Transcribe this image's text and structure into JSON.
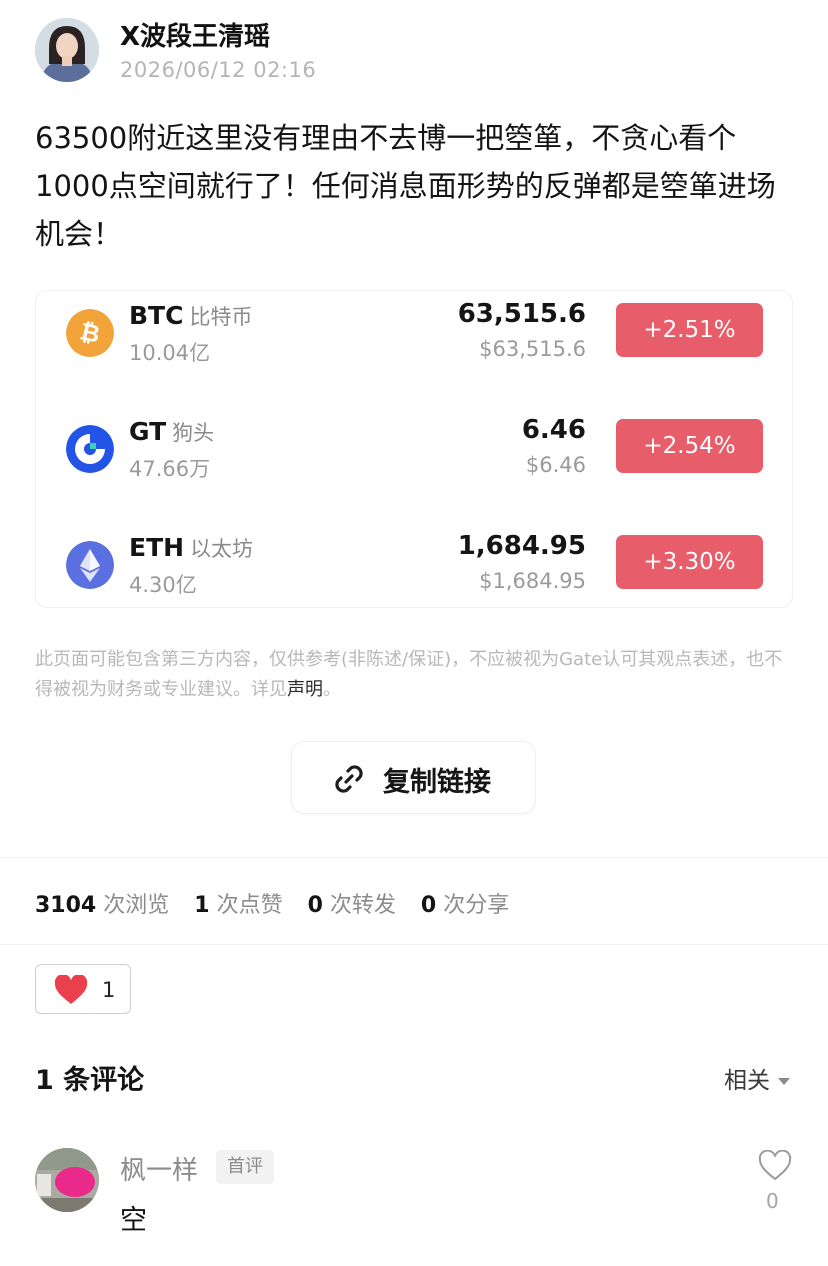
{
  "post": {
    "author": "X波段王清瑶",
    "timestamp": "2026/06/12 02:16",
    "body": "63500附近这里没有理由不去博一把箜箪，不贪心看个1000点空间就行了！任何消息面形势的反弹都是箜箪进场机会！"
  },
  "coins": [
    {
      "symbol": "BTC",
      "name_cn": "比特币",
      "volume": "10.04亿",
      "price": "63,515.6",
      "price_usd": "$63,515.6",
      "change": "+2.51%",
      "icon": "bitcoin-icon",
      "icon_color": "#f2a33a"
    },
    {
      "symbol": "GT",
      "name_cn": "狗头",
      "volume": "47.66万",
      "price": "6.46",
      "price_usd": "$6.46",
      "change": "+2.54%",
      "icon": "gatetoken-icon",
      "icon_color": "#2354e6"
    },
    {
      "symbol": "ETH",
      "name_cn": "以太坊",
      "volume": "4.30亿",
      "price": "1,684.95",
      "price_usd": "$1,684.95",
      "change": "+3.30%",
      "icon": "ethereum-icon",
      "icon_color": "#5a6fe0"
    }
  ],
  "change_color": "#e85d6a",
  "disclaimer": {
    "text": "此页面可能包含第三方内容，仅供参考(非陈述/保证)，不应被视为Gate认可其观点表述，也不得被视为财务或专业建议。详见",
    "link": "声明",
    "end": "。"
  },
  "copy_link": {
    "label": "复制链接",
    "icon": "link-icon"
  },
  "stats": {
    "views": "3104",
    "views_label": "次浏览",
    "likes": "1",
    "likes_label": "次点赞",
    "reposts": "0",
    "reposts_label": "次转发",
    "shares": "0",
    "shares_label": "次分享"
  },
  "reaction": {
    "icon": "heart-icon",
    "count": "1",
    "color": "#ea3f4d"
  },
  "comments": {
    "title": "1 条评论",
    "sort": "相关",
    "items": [
      {
        "user": "枫一样",
        "badge": "首评",
        "text": "空",
        "likes": "0"
      }
    ]
  }
}
